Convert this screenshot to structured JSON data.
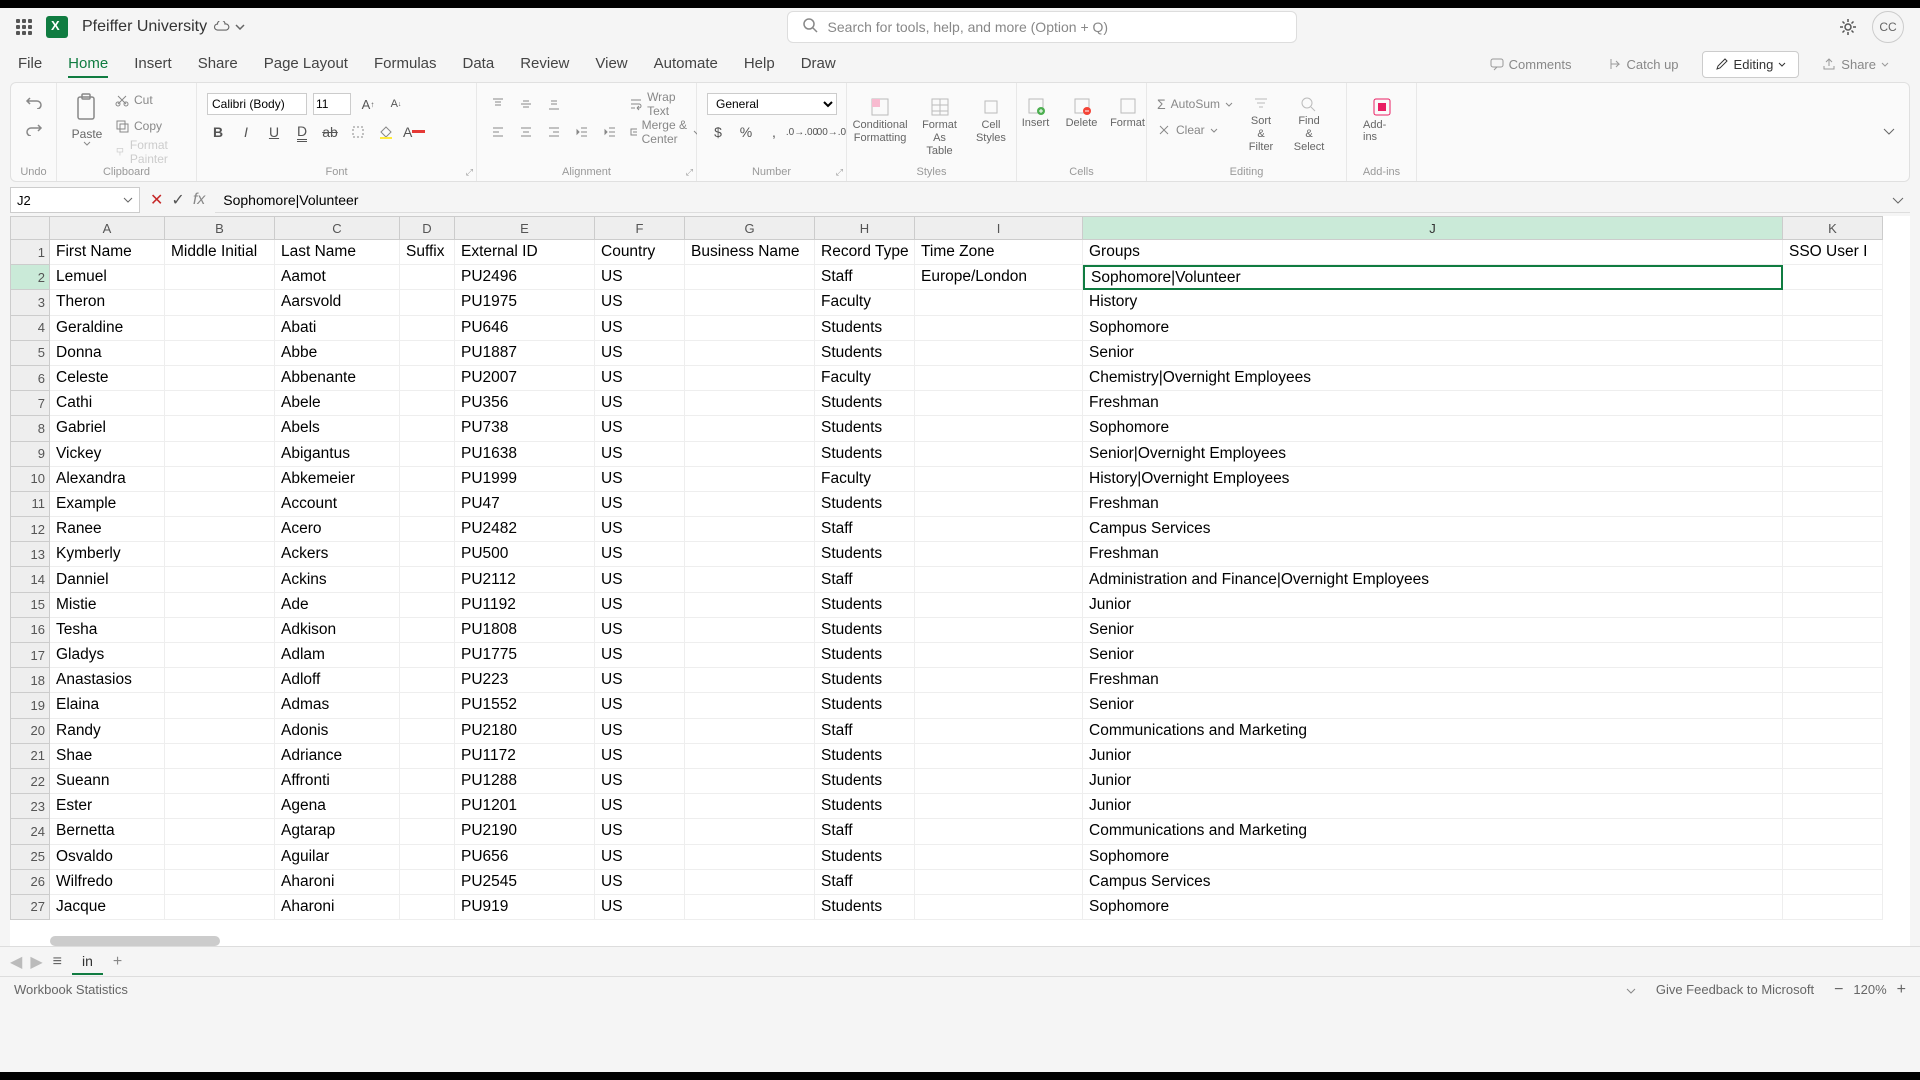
{
  "title": "Pfeiffer University",
  "search_placeholder": "Search for tools, help, and more (Option + Q)",
  "avatar": "CC",
  "menu": {
    "items": [
      "File",
      "Home",
      "Insert",
      "Share",
      "Page Layout",
      "Formulas",
      "Data",
      "Review",
      "View",
      "Automate",
      "Help",
      "Draw"
    ],
    "active": 1
  },
  "menu_right": {
    "comments": "Comments",
    "catchup": "Catch up",
    "editing": "Editing",
    "share": "Share"
  },
  "ribbon": {
    "undo": "Undo",
    "clipboard": {
      "paste": "Paste",
      "cut": "Cut",
      "copy": "Copy",
      "painter": "Format Painter",
      "label": "Clipboard"
    },
    "font": {
      "name": "Calibri (Body)",
      "size": "11",
      "label": "Font"
    },
    "alignment": {
      "wrap": "Wrap Text",
      "merge": "Merge & Center",
      "label": "Alignment"
    },
    "number": {
      "fmt": "General",
      "label": "Number"
    },
    "styles": {
      "conditional": "Conditional Formatting",
      "table": "Format As Table",
      "cell": "Cell Styles",
      "label": "Styles"
    },
    "cells": {
      "insert": "Insert",
      "delete": "Delete",
      "format": "Format",
      "label": "Cells"
    },
    "editing": {
      "autosum": "AutoSum",
      "clear": "Clear",
      "sort": "Sort & Filter",
      "find": "Find & Select",
      "label": "Editing"
    },
    "addins": {
      "btn": "Add-ins",
      "label": "Add-ins"
    }
  },
  "namebox": "J2",
  "formula": "Sophomore|Volunteer",
  "columns": [
    "A",
    "B",
    "C",
    "D",
    "E",
    "F",
    "G",
    "H",
    "I",
    "J",
    "K"
  ],
  "selected_col": 9,
  "headers": [
    "First Name",
    "Middle Initial",
    "Last Name",
    "Suffix",
    "External ID",
    "Country",
    "Business Name",
    "Record Type",
    "Time Zone",
    "Groups",
    "SSO User I"
  ],
  "rows": [
    {
      "n": 2,
      "d": [
        "Lemuel",
        "",
        "Aamot",
        "",
        "PU2496",
        "US",
        "",
        "Staff",
        "Europe/London",
        "Sophomore|Volunteer",
        ""
      ]
    },
    {
      "n": 3,
      "d": [
        "Theron",
        "",
        "Aarsvold",
        "",
        "PU1975",
        "US",
        "",
        "Faculty",
        "",
        "History",
        ""
      ]
    },
    {
      "n": 4,
      "d": [
        "Geraldine",
        "",
        "Abati",
        "",
        "PU646",
        "US",
        "",
        "Students",
        "",
        "Sophomore",
        ""
      ]
    },
    {
      "n": 5,
      "d": [
        "Donna",
        "",
        "Abbe",
        "",
        "PU1887",
        "US",
        "",
        "Students",
        "",
        "Senior",
        ""
      ]
    },
    {
      "n": 6,
      "d": [
        "Celeste",
        "",
        "Abbenante",
        "",
        "PU2007",
        "US",
        "",
        "Faculty",
        "",
        "Chemistry|Overnight Employees",
        ""
      ]
    },
    {
      "n": 7,
      "d": [
        "Cathi",
        "",
        "Abele",
        "",
        "PU356",
        "US",
        "",
        "Students",
        "",
        "Freshman",
        ""
      ]
    },
    {
      "n": 8,
      "d": [
        "Gabriel",
        "",
        "Abels",
        "",
        "PU738",
        "US",
        "",
        "Students",
        "",
        "Sophomore",
        ""
      ]
    },
    {
      "n": 9,
      "d": [
        "Vickey",
        "",
        "Abigantus",
        "",
        "PU1638",
        "US",
        "",
        "Students",
        "",
        "Senior|Overnight Employees",
        ""
      ]
    },
    {
      "n": 10,
      "d": [
        "Alexandra",
        "",
        "Abkemeier",
        "",
        "PU1999",
        "US",
        "",
        "Faculty",
        "",
        "History|Overnight Employees",
        ""
      ]
    },
    {
      "n": 11,
      "d": [
        "Example",
        "",
        "Account",
        "",
        "PU47",
        "US",
        "",
        "Students",
        "",
        "Freshman",
        ""
      ]
    },
    {
      "n": 12,
      "d": [
        "Ranee",
        "",
        "Acero",
        "",
        "PU2482",
        "US",
        "",
        "Staff",
        "",
        "Campus Services",
        ""
      ]
    },
    {
      "n": 13,
      "d": [
        "Kymberly",
        "",
        "Ackers",
        "",
        "PU500",
        "US",
        "",
        "Students",
        "",
        "Freshman",
        ""
      ]
    },
    {
      "n": 14,
      "d": [
        "Danniel",
        "",
        "Ackins",
        "",
        "PU2112",
        "US",
        "",
        "Staff",
        "",
        "Administration and Finance|Overnight Employees",
        ""
      ]
    },
    {
      "n": 15,
      "d": [
        "Mistie",
        "",
        "Ade",
        "",
        "PU1192",
        "US",
        "",
        "Students",
        "",
        "Junior",
        ""
      ]
    },
    {
      "n": 16,
      "d": [
        "Tesha",
        "",
        "Adkison",
        "",
        "PU1808",
        "US",
        "",
        "Students",
        "",
        "Senior",
        ""
      ]
    },
    {
      "n": 17,
      "d": [
        "Gladys",
        "",
        "Adlam",
        "",
        "PU1775",
        "US",
        "",
        "Students",
        "",
        "Senior",
        ""
      ]
    },
    {
      "n": 18,
      "d": [
        "Anastasios",
        "",
        "Adloff",
        "",
        "PU223",
        "US",
        "",
        "Students",
        "",
        "Freshman",
        ""
      ]
    },
    {
      "n": 19,
      "d": [
        "Elaina",
        "",
        "Admas",
        "",
        "PU1552",
        "US",
        "",
        "Students",
        "",
        "Senior",
        ""
      ]
    },
    {
      "n": 20,
      "d": [
        "Randy",
        "",
        "Adonis",
        "",
        "PU2180",
        "US",
        "",
        "Staff",
        "",
        "Communications and Marketing",
        ""
      ]
    },
    {
      "n": 21,
      "d": [
        "Shae",
        "",
        "Adriance",
        "",
        "PU1172",
        "US",
        "",
        "Students",
        "",
        "Junior",
        ""
      ]
    },
    {
      "n": 22,
      "d": [
        "Sueann",
        "",
        "Affronti",
        "",
        "PU1288",
        "US",
        "",
        "Students",
        "",
        "Junior",
        ""
      ]
    },
    {
      "n": 23,
      "d": [
        "Ester",
        "",
        "Agena",
        "",
        "PU1201",
        "US",
        "",
        "Students",
        "",
        "Junior",
        ""
      ]
    },
    {
      "n": 24,
      "d": [
        "Bernetta",
        "",
        "Agtarap",
        "",
        "PU2190",
        "US",
        "",
        "Staff",
        "",
        "Communications and Marketing",
        ""
      ]
    },
    {
      "n": 25,
      "d": [
        "Osvaldo",
        "",
        "Aguilar",
        "",
        "PU656",
        "US",
        "",
        "Students",
        "",
        "Sophomore",
        ""
      ]
    },
    {
      "n": 26,
      "d": [
        "Wilfredo",
        "",
        "Aharoni",
        "",
        "PU2545",
        "US",
        "",
        "Staff",
        "",
        "Campus Services",
        ""
      ]
    },
    {
      "n": 27,
      "d": [
        "Jacque",
        "",
        "Aharoni",
        "",
        "PU919",
        "US",
        "",
        "Students",
        "",
        "Sophomore",
        ""
      ]
    }
  ],
  "active_cell": {
    "row": 2,
    "col": 9
  },
  "sheet": "in",
  "status": {
    "left": "Workbook Statistics",
    "feedback": "Give Feedback to Microsoft",
    "zoom": "120%"
  }
}
